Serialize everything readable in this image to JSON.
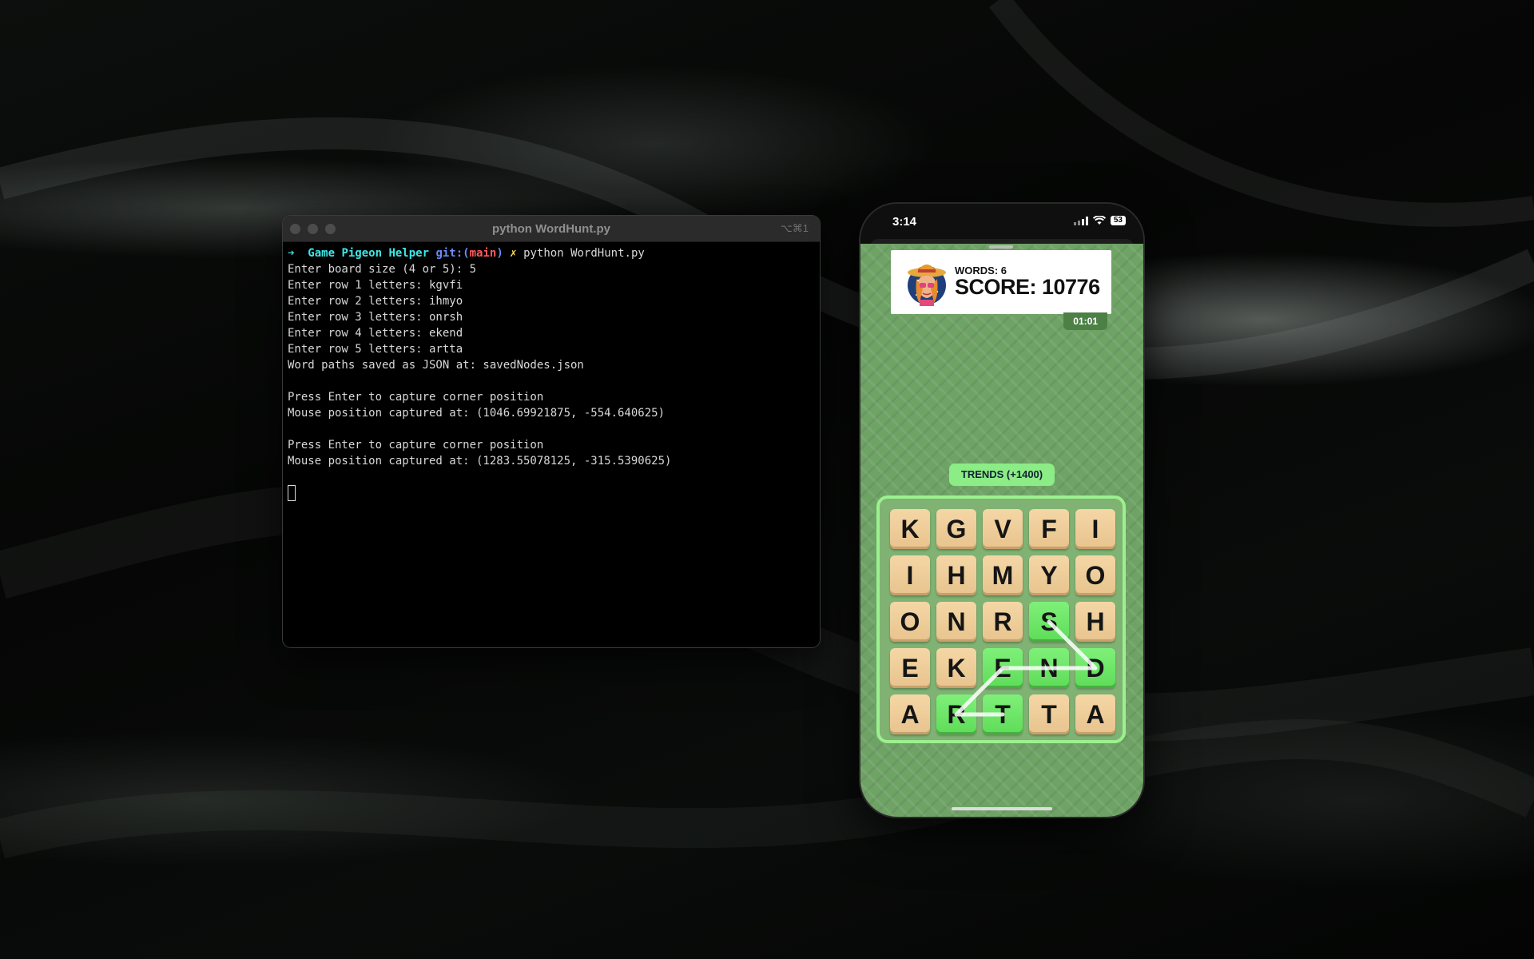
{
  "terminal": {
    "title": "python WordHunt.py",
    "shortcut": "⌥⌘1",
    "prompt": {
      "arrow": "➜",
      "dir": "Game Pigeon Helper",
      "git_label": "git:(",
      "branch": "main",
      "git_close": ")",
      "dirty_mark": "✗",
      "command": "python WordHunt.py"
    },
    "lines": [
      "Enter board size (4 or 5): 5",
      "Enter row 1 letters: kgvfi",
      "Enter row 2 letters: ihmyo",
      "Enter row 3 letters: onrsh",
      "Enter row 4 letters: ekend",
      "Enter row 5 letters: artta",
      "Word paths saved as JSON at: savedNodes.json",
      "",
      "Press Enter to capture corner position",
      "Mouse position captured at: (1046.69921875, -554.640625)",
      "",
      "Press Enter to capture corner position",
      "Mouse position captured at: (1283.55078125, -315.5390625)"
    ]
  },
  "phone": {
    "time": "3:14",
    "battery": "53",
    "words_label": "WORDS: 6",
    "score_label": "SCORE: 10776",
    "timer": "01:01",
    "current_word": "TRENDS (+1400)",
    "board": [
      [
        "K",
        "G",
        "V",
        "F",
        "I"
      ],
      [
        "I",
        "H",
        "M",
        "Y",
        "O"
      ],
      [
        "O",
        "N",
        "R",
        "S",
        "H"
      ],
      [
        "E",
        "K",
        "E",
        "N",
        "D"
      ],
      [
        "A",
        "R",
        "T",
        "T",
        "A"
      ]
    ],
    "selected": [
      [
        2,
        3
      ],
      [
        3,
        2
      ],
      [
        3,
        3
      ],
      [
        3,
        4
      ],
      [
        4,
        1
      ],
      [
        4,
        2
      ]
    ],
    "path": [
      [
        4,
        2
      ],
      [
        4,
        1
      ],
      [
        3,
        2
      ],
      [
        3,
        3
      ],
      [
        3,
        4
      ],
      [
        2,
        3
      ]
    ]
  },
  "colors": {
    "game_bg": "#6fa366",
    "selected_tile": "#6be865",
    "tile": "#eccb98",
    "pill": "#8cec86"
  }
}
